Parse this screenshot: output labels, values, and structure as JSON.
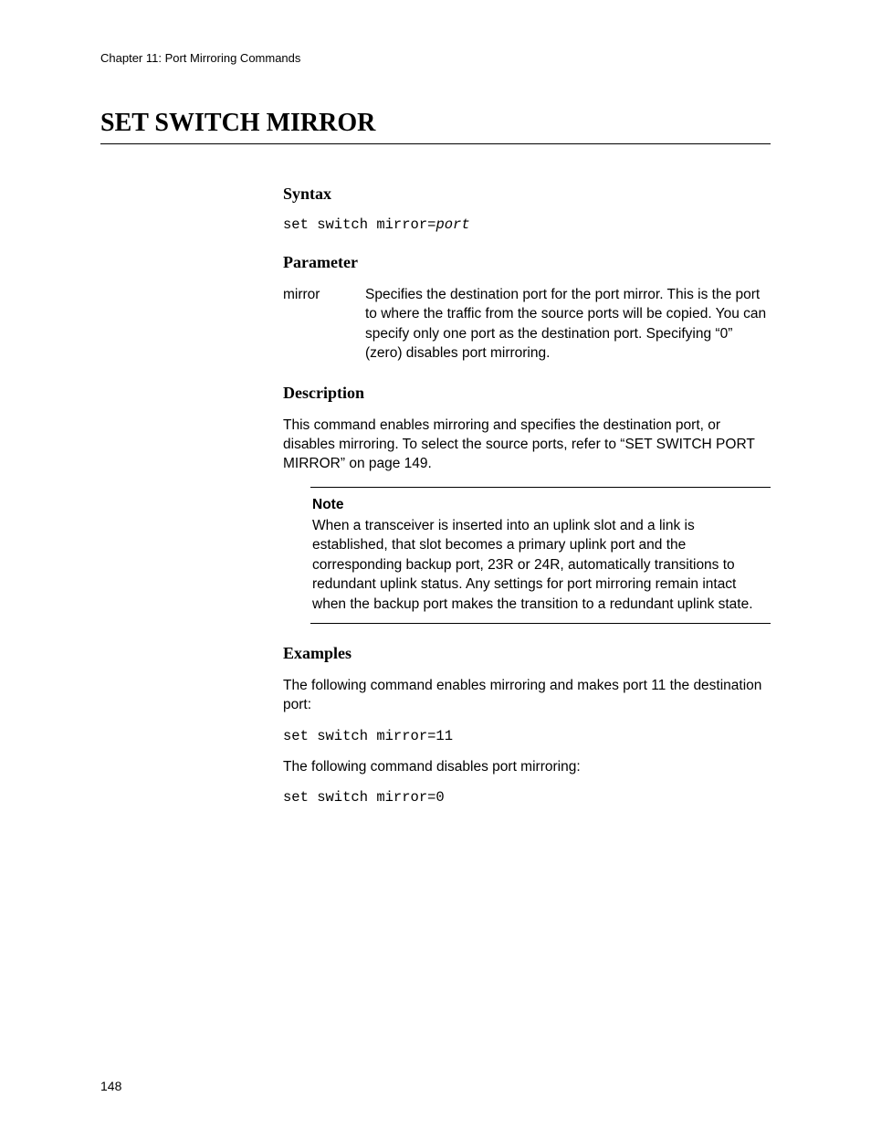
{
  "header": {
    "chapter": "Chapter 11: Port Mirroring Commands"
  },
  "title": "SET SWITCH MIRROR",
  "syntax": {
    "heading": "Syntax",
    "cmd_prefix": "set switch mirror=",
    "cmd_var": "port"
  },
  "parameter": {
    "heading": "Parameter",
    "name": "mirror",
    "desc": "Specifies the destination port for the port mirror. This is the port to where the traffic from the source ports will be copied. You can specify only one port as the destination port. Specifying “0” (zero) disables port mirroring."
  },
  "description": {
    "heading": "Description",
    "text": "This command enables mirroring and specifies the destination port, or disables mirroring. To select the source ports, refer to “SET SWITCH PORT MIRROR” on page 149."
  },
  "note": {
    "label": "Note",
    "text": "When a transceiver is inserted into an uplink slot and a link is established, that slot becomes a primary uplink port and the corresponding backup port, 23R or 24R, automatically transitions to redundant uplink status. Any settings for port mirroring remain intact when the backup port makes the transition to a redundant uplink state."
  },
  "examples": {
    "heading": "Examples",
    "intro1": "The following command enables mirroring and makes port 11 the destination port:",
    "cmd1": "set switch mirror=11",
    "intro2": "The following command disables port mirroring:",
    "cmd2": "set switch mirror=0"
  },
  "page_number": "148"
}
